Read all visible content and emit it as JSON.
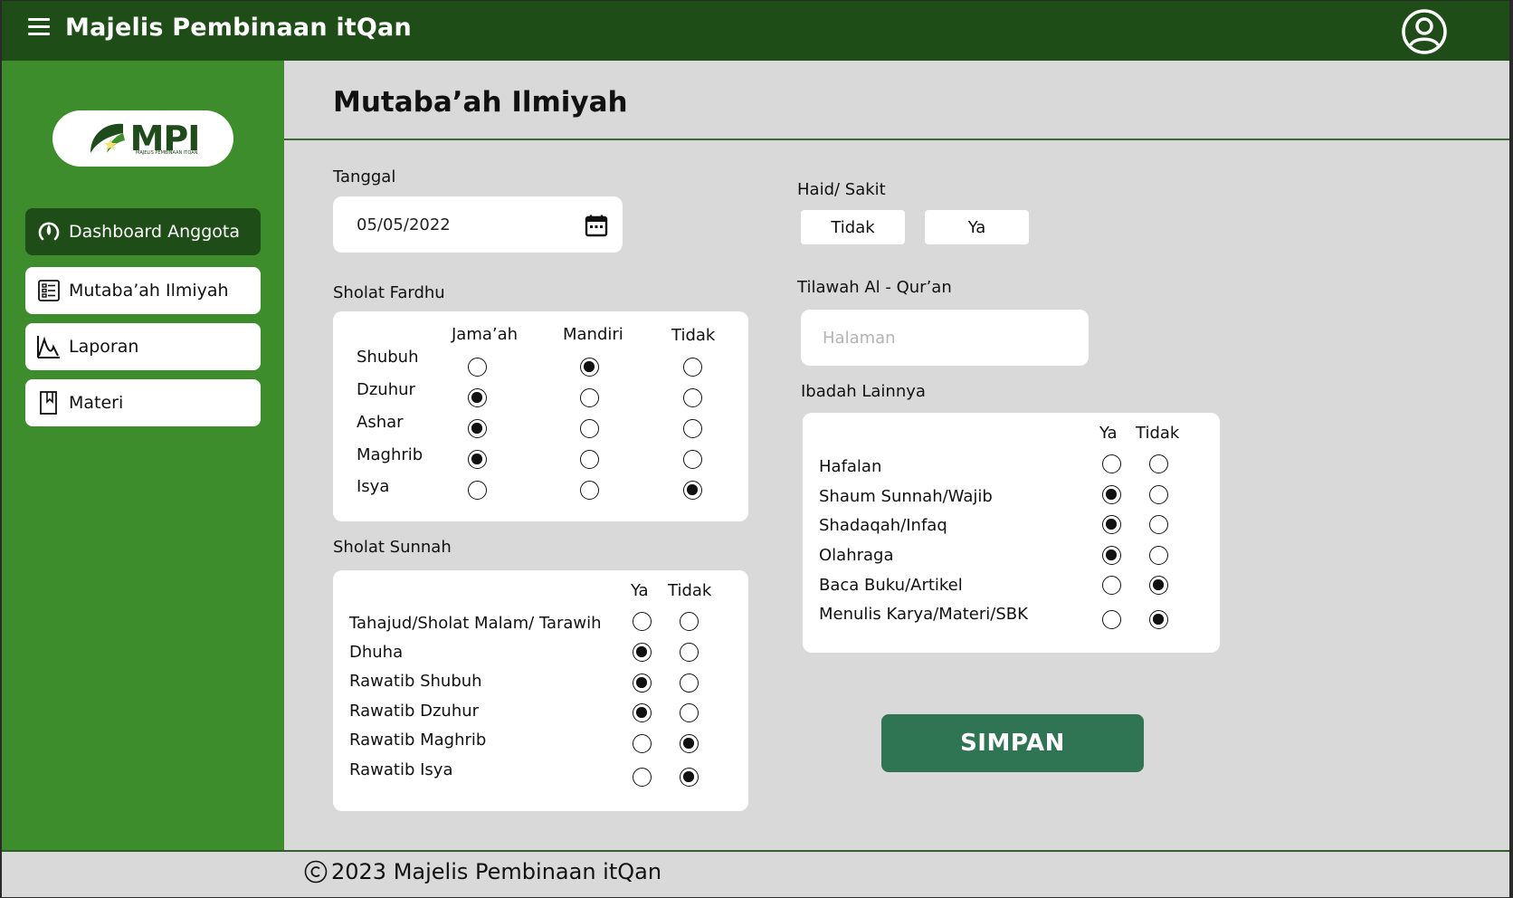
{
  "app": {
    "title": "Majelis Pembinaan itQan"
  },
  "colors": {
    "topbar": "#1e4d17",
    "sidebar": "#3e8d2c",
    "active_nav": "#1e4d17",
    "save_button": "#2f7453",
    "background": "#d9d9d9"
  },
  "logo": {
    "text": "MPI",
    "subtitle": "MAJELIS PEMBINAAN ITQAN"
  },
  "sidebar": {
    "items": [
      {
        "label": "Dashboard Anggota",
        "icon": "gauge-icon",
        "active": true
      },
      {
        "label": "Mutaba’ah Ilmiyah",
        "icon": "checklist-icon",
        "active": false
      },
      {
        "label": "Laporan",
        "icon": "chart-icon",
        "active": false
      },
      {
        "label": "Materi",
        "icon": "bookmark-icon",
        "active": false
      }
    ]
  },
  "page": {
    "title": "Mutaba’ah Ilmiyah"
  },
  "tanggal": {
    "label": "Tanggal",
    "value": "05/05/2022"
  },
  "sholat_fardhu": {
    "label": "Sholat Fardhu",
    "columns": [
      "Jama’ah",
      "Mandiri",
      "Tidak"
    ],
    "rows": [
      {
        "name": "Shubuh",
        "selected": 1
      },
      {
        "name": "Dzuhur",
        "selected": 0
      },
      {
        "name": "Ashar",
        "selected": 0
      },
      {
        "name": "Maghrib",
        "selected": 0
      },
      {
        "name": "Isya",
        "selected": 2
      }
    ]
  },
  "sholat_sunnah": {
    "label": "Sholat Sunnah",
    "columns": [
      "Ya",
      "Tidak"
    ],
    "rows": [
      {
        "name": "Tahajud/Sholat Malam/ Tarawih",
        "selected": -1
      },
      {
        "name": "Dhuha",
        "selected": 0
      },
      {
        "name": "Rawatib Shubuh",
        "selected": 0
      },
      {
        "name": "Rawatib Dzuhur",
        "selected": 0
      },
      {
        "name": "Rawatib Maghrib",
        "selected": 1
      },
      {
        "name": "Rawatib Isya",
        "selected": 1
      }
    ]
  },
  "haid": {
    "label": "Haid/ Sakit",
    "options": [
      "Tidak",
      "Ya"
    ]
  },
  "tilawah": {
    "label": "Tilawah Al - Qur’an",
    "placeholder": "Halaman",
    "value": ""
  },
  "ibadah_lainnya": {
    "label": "Ibadah Lainnya",
    "columns": [
      "Ya",
      "Tidak"
    ],
    "rows": [
      {
        "name": "Hafalan",
        "selected": -1
      },
      {
        "name": "Shaum Sunnah/Wajib",
        "selected": 0
      },
      {
        "name": "Shadaqah/Infaq",
        "selected": 0
      },
      {
        "name": "Olahraga",
        "selected": 0
      },
      {
        "name": "Baca Buku/Artikel",
        "selected": 1
      },
      {
        "name": "Menulis Karya/Materi/SBK",
        "selected": 1
      }
    ]
  },
  "actions": {
    "save_label": "SIMPAN"
  },
  "footer": {
    "text": "2023 Majelis Pembinaan itQan"
  }
}
